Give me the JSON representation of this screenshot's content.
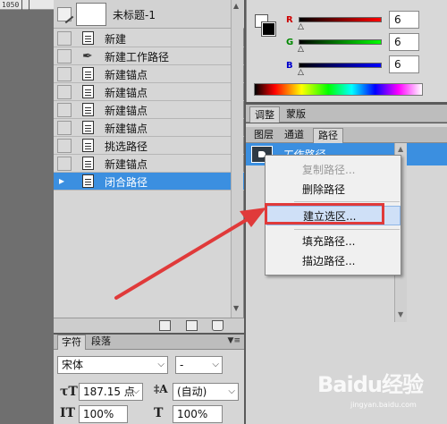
{
  "ruler": {
    "text": "1050"
  },
  "history": {
    "snapshot_label": "未标题-1",
    "items": [
      {
        "label": "新建",
        "icon": "document-icon"
      },
      {
        "label": "新建工作路径",
        "icon": "pen-icon"
      },
      {
        "label": "新建锚点",
        "icon": "document-icon"
      },
      {
        "label": "新建锚点",
        "icon": "document-icon"
      },
      {
        "label": "新建锚点",
        "icon": "document-icon"
      },
      {
        "label": "新建锚点",
        "icon": "document-icon"
      },
      {
        "label": "挑选路径",
        "icon": "document-icon"
      },
      {
        "label": "新建锚点",
        "icon": "document-icon"
      },
      {
        "label": "闭合路径",
        "icon": "document-icon",
        "selected": true
      }
    ]
  },
  "character": {
    "tabs": [
      "字符",
      "段落"
    ],
    "font_family": "宋体",
    "font_style": "-",
    "font_size": "187.15 点",
    "leading": "(自动)",
    "vscale": "100%",
    "hscale": "100%"
  },
  "color": {
    "channels": [
      {
        "label": "R",
        "value": "6"
      },
      {
        "label": "G",
        "value": "6"
      },
      {
        "label": "B",
        "value": "6"
      }
    ],
    "accent_red": "#e03a3a",
    "selection_blue": "#3b8fe0"
  },
  "adjust_tabs": [
    "调整",
    "蒙版"
  ],
  "paths_tabs": [
    "图层",
    "通道",
    "路径"
  ],
  "paths": {
    "item_label": "工作路径"
  },
  "context_menu": {
    "items": [
      "复制路径...",
      "删除路径",
      "建立选区...",
      "填充路径...",
      "描边路径..."
    ]
  },
  "watermark": {
    "brand": "Baidu经验",
    "url": "jingyan.baidu.com"
  }
}
